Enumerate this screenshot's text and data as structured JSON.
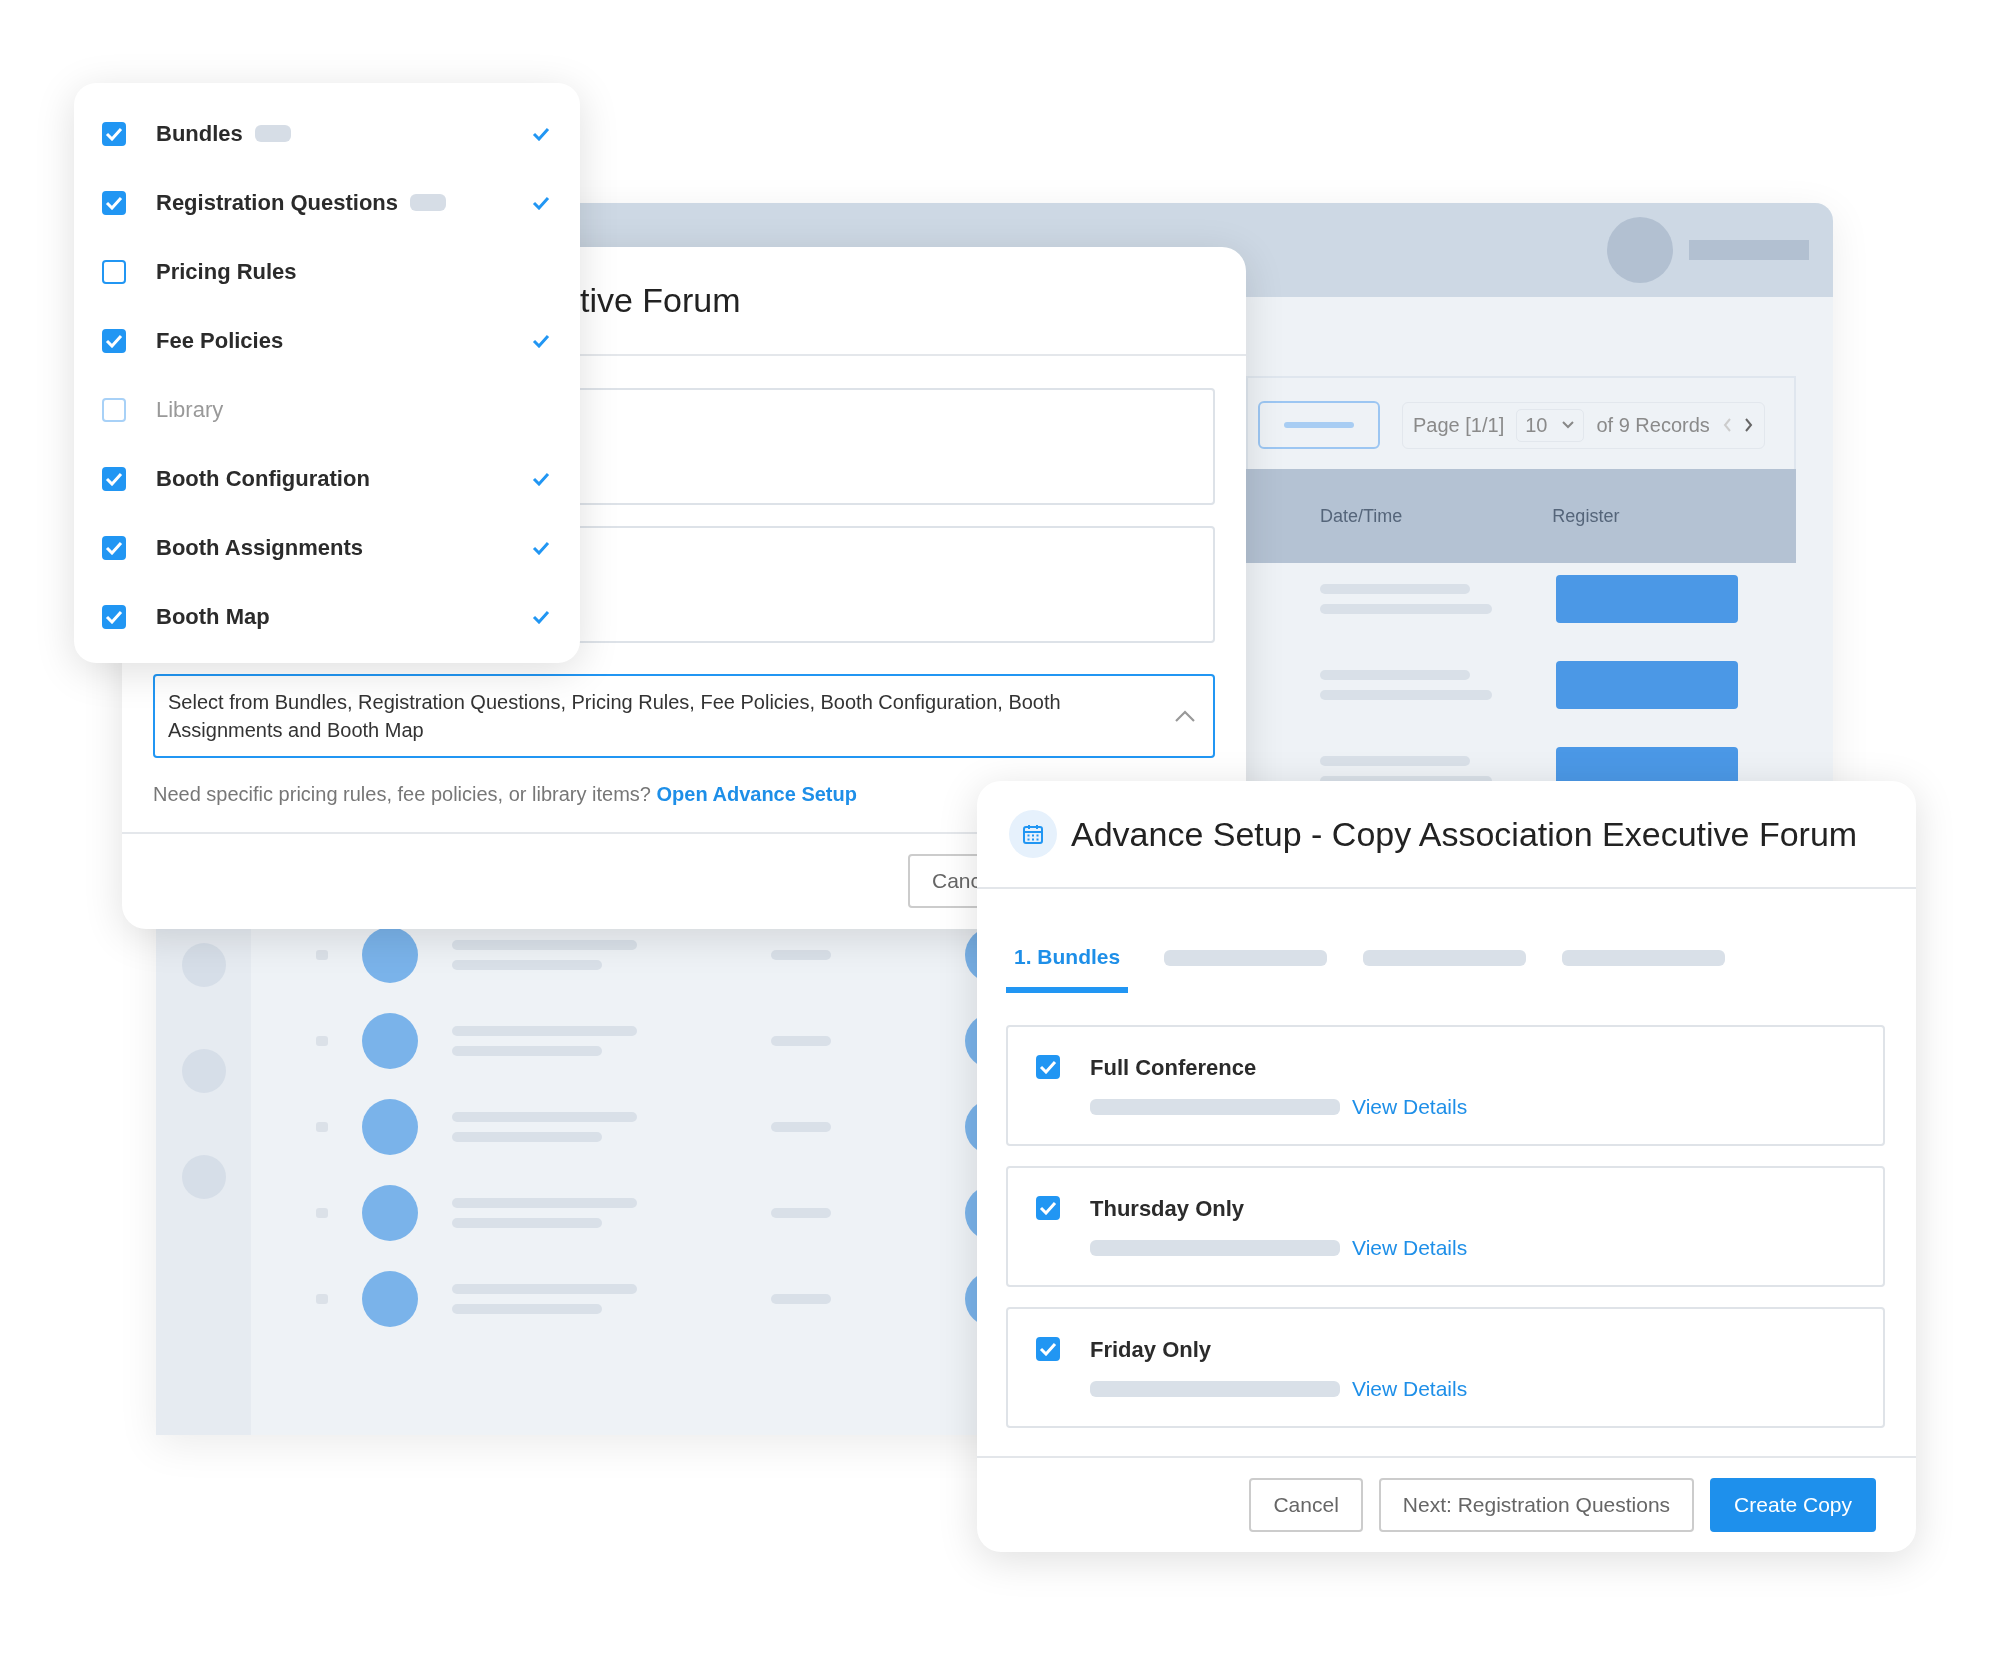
{
  "background_app": {
    "pagination": {
      "page": "Page [1/1]",
      "page_size": "10",
      "records": "of 9 Records"
    },
    "table_columns": [
      "Date/Time",
      "Register"
    ]
  },
  "item_menu": {
    "items": [
      {
        "label": "Bundles",
        "checked": true,
        "disabled": false,
        "tag": true
      },
      {
        "label": "Registration Questions",
        "checked": true,
        "disabled": false,
        "tag": true
      },
      {
        "label": "Pricing Rules",
        "checked": false,
        "disabled": false,
        "tag": false
      },
      {
        "label": "Fee Policies",
        "checked": true,
        "disabled": false,
        "tag": false
      },
      {
        "label": "Library",
        "checked": false,
        "disabled": true,
        "tag": false
      },
      {
        "label": "Booth Configuration",
        "checked": true,
        "disabled": false,
        "tag": false
      },
      {
        "label": "Booth Assignments",
        "checked": true,
        "disabled": false,
        "tag": false
      },
      {
        "label": "Booth Map",
        "checked": true,
        "disabled": false,
        "tag": false
      }
    ]
  },
  "copy_dialog": {
    "title": "tive Forum",
    "select_field": {
      "value": "Select from Bundles, Registration Questions, Pricing Rules, Fee Policies, Booth Configuration, Booth Assignments and Booth Map",
      "expanded": true
    },
    "helper": {
      "text": "Need specific pricing rules, fee policies, or library items?",
      "link": "Open Advance Setup"
    },
    "cancel_button": "Canc"
  },
  "advance_setup": {
    "title": "Advance Setup - Copy Association Executive Forum",
    "tabs": [
      {
        "label": "1. Bundles",
        "selected": true
      }
    ],
    "bundles": [
      {
        "name": "Full Conference",
        "checked": true,
        "link": "View Details"
      },
      {
        "name": "Thursday Only",
        "checked": true,
        "link": "View Details"
      },
      {
        "name": "Friday Only",
        "checked": true,
        "link": "View Details"
      }
    ],
    "buttons": [
      {
        "label": "Cancel",
        "kind": "secondary"
      },
      {
        "label": "Next: Registration Questions",
        "kind": "secondary"
      },
      {
        "label": "Create Copy",
        "kind": "primary"
      }
    ]
  }
}
